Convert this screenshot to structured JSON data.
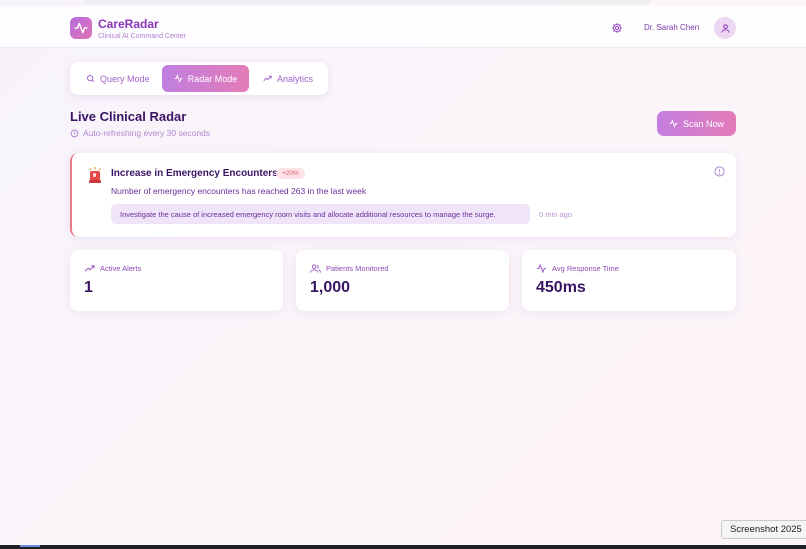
{
  "app": {
    "name": "CareRadar",
    "subtitle": "Clinical AI Command Center",
    "user": "Dr. Sarah Chen"
  },
  "modes": [
    {
      "label": "Query Mode",
      "icon": "search-icon",
      "active": false
    },
    {
      "label": "Radar Mode",
      "icon": "activity-icon",
      "active": true
    },
    {
      "label": "Analytics",
      "icon": "trending-up-icon",
      "active": false
    }
  ],
  "radar": {
    "title": "Live Clinical Radar",
    "refresh": "Auto-refreshing every 30 seconds",
    "scan_label": "Scan Now"
  },
  "alert": {
    "title": "Increase in Emergency Encounters",
    "badge": "+20%",
    "description": "Number of emergency encounters has reached 263 in the last week",
    "recommendation": "Investigate the cause of increased emergency room visits and allocate additional resources to manage the surge.",
    "time": "0 min ago"
  },
  "stats": [
    {
      "label": "Active Alerts",
      "value": "1",
      "icon": "trending-up-icon"
    },
    {
      "label": "Patients Monitored",
      "value": "1,000",
      "icon": "users-icon"
    },
    {
      "label": "Avg Response Time",
      "value": "450ms",
      "icon": "activity-icon"
    }
  ],
  "system": {
    "tooltip": "Screenshot 2025"
  },
  "colors": {
    "accent": "#c07ee0",
    "accent_pink": "#e47cb8",
    "alert_border": "#ea7a86",
    "text_dark": "#3a1463"
  }
}
